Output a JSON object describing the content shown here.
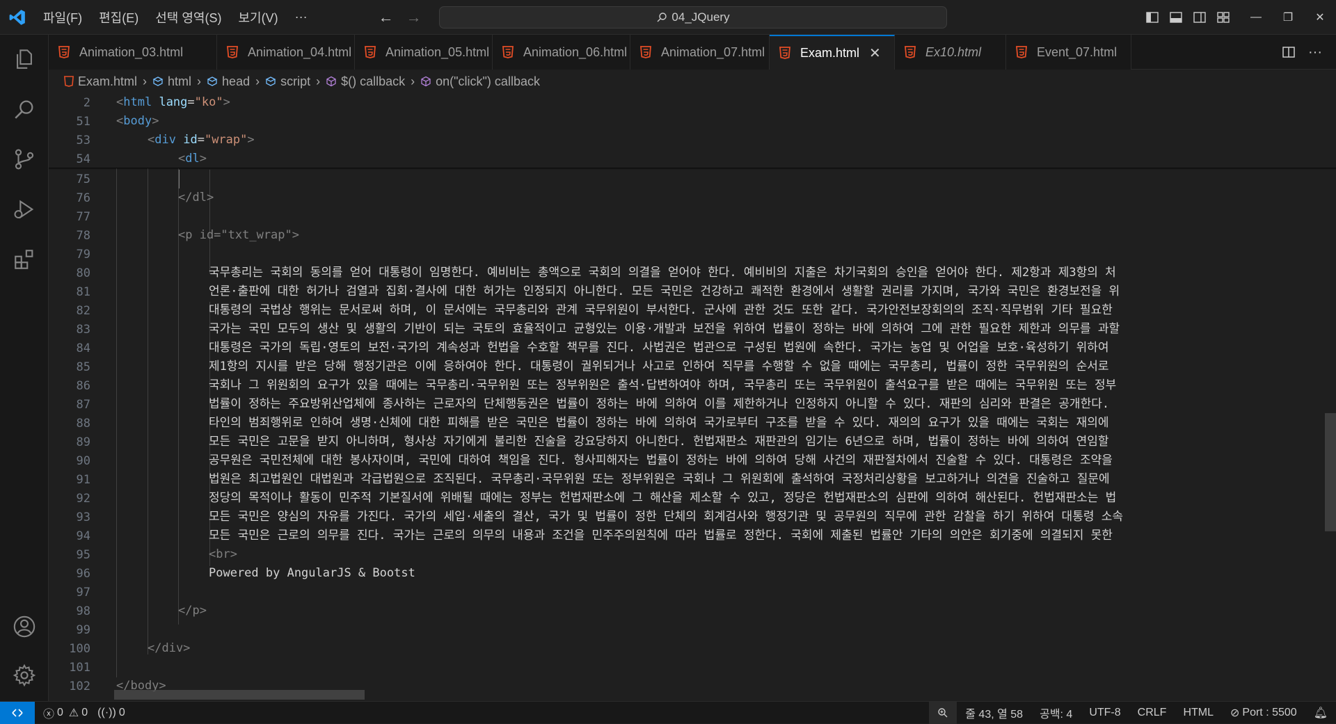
{
  "titlebar": {
    "menu": [
      "파일(F)",
      "편집(E)",
      "선택 영역(S)",
      "보기(V)",
      "···"
    ],
    "search_text": "04_JQuery"
  },
  "tabs": [
    {
      "label": "Animation_03.html",
      "italic": false
    },
    {
      "label": "Animation_04.html",
      "italic": false
    },
    {
      "label": "Animation_05.html",
      "italic": false
    },
    {
      "label": "Animation_06.html",
      "italic": false
    },
    {
      "label": "Animation_07.html",
      "italic": false
    },
    {
      "label": "Exam.html",
      "italic": false,
      "active": true
    },
    {
      "label": "Ex10.html",
      "italic": true
    },
    {
      "label": "Event_07.html",
      "italic": false
    }
  ],
  "breadcrumb": [
    "Exam.html",
    "html",
    "head",
    "script",
    "$() callback",
    "on(\"click\") callback"
  ],
  "sticky_lines": [
    {
      "num": "2",
      "tag": "html",
      "attr": "lang",
      "val": "\"ko\""
    },
    {
      "num": "51",
      "tag": "body"
    },
    {
      "num": "53",
      "tag": "div",
      "attr": "id",
      "val": "\"wrap\""
    },
    {
      "num": "54",
      "tag": "dl"
    }
  ],
  "code_lines": [
    {
      "num": "75",
      "text": ""
    },
    {
      "num": "76",
      "text": "</dl>"
    },
    {
      "num": "77",
      "text": ""
    },
    {
      "num": "78",
      "text": "<p id=\"txt_wrap\">"
    },
    {
      "num": "79",
      "text": ""
    },
    {
      "num": "80",
      "text": "국무총리는 국회의 동의를 얻어 대통령이 임명한다. 예비비는 총액으로 국회의 의결을 얻어야 한다. 예비비의 지출은 차기국회의 승인을 얻어야 한다. 제2항과 제3항의 처"
    },
    {
      "num": "81",
      "text": "언론·출판에 대한 허가나 검열과 집회·결사에 대한 허가는 인정되지 아니한다. 모든 국민은 건강하고 쾌적한 환경에서 생활할 권리를 가지며, 국가와 국민은 환경보전을 위"
    },
    {
      "num": "82",
      "text": "대통령의 국법상 행위는 문서로써 하며, 이 문서에는 국무총리와 관계 국무위원이 부서한다. 군사에 관한 것도 또한 같다. 국가안전보장회의의 조직·직무범위 기타 필요한"
    },
    {
      "num": "83",
      "text": "국가는 국민 모두의 생산 및 생활의 기반이 되는 국토의 효율적이고 균형있는 이용·개발과 보전을 위하여 법률이 정하는 바에 의하여 그에 관한 필요한 제한과 의무를 과할"
    },
    {
      "num": "84",
      "text": "대통령은 국가의 독립·영토의 보전·국가의 계속성과 헌법을 수호할 책무를 진다. 사법권은 법관으로 구성된 법원에 속한다. 국가는 농업 및 어업을 보호·육성하기 위하여"
    },
    {
      "num": "85",
      "text": "제1항의 지시를 받은 당해 행정기관은 이에 응하여야 한다. 대통령이 궐위되거나 사고로 인하여 직무를 수행할 수 없을 때에는 국무총리, 법률이 정한 국무위원의 순서로"
    },
    {
      "num": "86",
      "text": "국회나 그 위원회의 요구가 있을 때에는 국무총리·국무위원 또는 정부위원은 출석·답변하여야 하며, 국무총리 또는 국무위원이 출석요구를 받은 때에는 국무위원 또는 정부"
    },
    {
      "num": "87",
      "text": "법률이 정하는 주요방위산업체에 종사하는 근로자의 단체행동권은 법률이 정하는 바에 의하여 이를 제한하거나 인정하지 아니할 수 있다. 재판의 심리와 판결은 공개한다."
    },
    {
      "num": "88",
      "text": "타인의 범죄행위로 인하여 생명·신체에 대한 피해를 받은 국민은 법률이 정하는 바에 의하여 국가로부터 구조를 받을 수 있다. 재의의 요구가 있을 때에는 국회는 재의에"
    },
    {
      "num": "89",
      "text": "모든 국민은 고문을 받지 아니하며, 형사상 자기에게 불리한 진술을 강요당하지 아니한다. 헌법재판소 재판관의 임기는 6년으로 하며, 법률이 정하는 바에 의하여 연임할"
    },
    {
      "num": "90",
      "text": "공무원은 국민전체에 대한 봉사자이며, 국민에 대하여 책임을 진다. 형사피해자는 법률이 정하는 바에 의하여 당해 사건의 재판절차에서 진술할 수 있다. 대통령은 조약을"
    },
    {
      "num": "91",
      "text": "법원은 최고법원인 대법원과 각급법원으로 조직된다. 국무총리·국무위원 또는 정부위원은 국회나 그 위원회에 출석하여 국정처리상황을 보고하거나 의견을 진술하고 질문에"
    },
    {
      "num": "92",
      "text": "정당의 목적이나 활동이 민주적 기본질서에 위배될 때에는 정부는 헌법재판소에 그 해산을 제소할 수 있고, 정당은 헌법재판소의 심판에 의하여 해산된다. 헌법재판소는 법"
    },
    {
      "num": "93",
      "text": "모든 국민은 양심의 자유를 가진다. 국가의 세입·세출의 결산, 국가 및 법률이 정한 단체의 회계검사와 행정기관 및 공무원의 직무에 관한 감찰을 하기 위하여 대통령 소속"
    },
    {
      "num": "94",
      "text": "모든 국민은 근로의 의무를 진다. 국가는 근로의 의무의 내용과 조건을 민주주의원칙에 따라 법률로 정한다. 국회에 제출된 법률안 기타의 의안은 회기중에 의결되지 못한"
    },
    {
      "num": "95",
      "text": "<br>"
    },
    {
      "num": "96",
      "text": "Powered by AngularJS & Bootst"
    },
    {
      "num": "97",
      "text": ""
    },
    {
      "num": "98",
      "text": "</p>"
    },
    {
      "num": "99",
      "text": ""
    },
    {
      "num": "100",
      "text": "</div>"
    },
    {
      "num": "101",
      "text": ""
    },
    {
      "num": "102",
      "text": "</body>"
    }
  ],
  "statusbar": {
    "errors": "0",
    "warnings": "0",
    "ports": "0",
    "position": "줄 43, 열 58",
    "spaces": "공백: 4",
    "encoding": "UTF-8",
    "eol": "CRLF",
    "language": "HTML",
    "port": "Port : 5500"
  },
  "colors": {
    "accent": "#0078d4",
    "html_icon": "#e44d26",
    "tag_name": "#569cd6",
    "attr_name": "#9cdcfe",
    "attr_value": "#ce9178"
  }
}
